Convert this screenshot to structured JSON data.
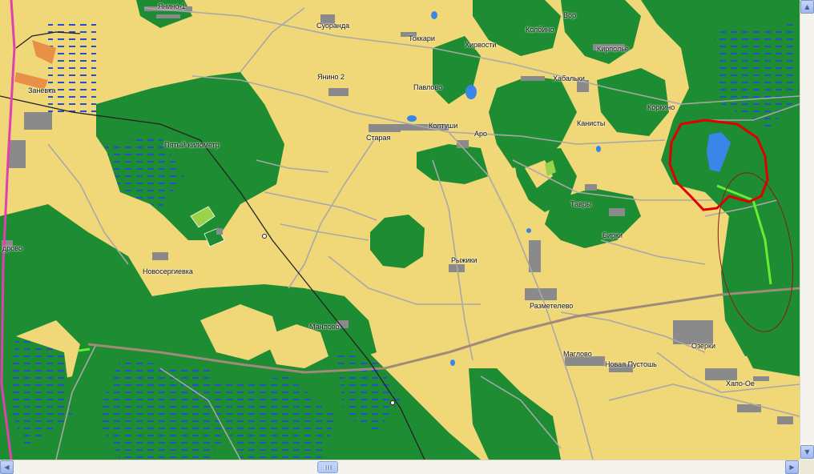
{
  "map": {
    "colors": {
      "field": "#f0d878",
      "forest": "#1e8c32",
      "water": "#3a86e8",
      "building": "#8a8a8a",
      "road": "#a8a8a8",
      "main_road": "#a08a7a",
      "rail": "#222222",
      "annotation_red": "#e00000",
      "track_green": "#66ee33"
    },
    "labels": {
      "yanino1": "Янино-1",
      "suoranda": "Суоранда",
      "tokkari": "Токкари",
      "kolbino": "Колбино",
      "vor": "Вор",
      "khirvosti": "Хирвости",
      "kirpolye": "Кирполье",
      "zanevka": "Заневка",
      "yanino2": "Янино 2",
      "pavlovo": "Павлово",
      "khabalki": "Хабальки",
      "korkino": "Коркино",
      "koltushi": "Колтуши",
      "kanisty": "Канисты",
      "pyatyy_km": "Пятый километр",
      "staraya": "Старая",
      "aro": "Аро",
      "tavry": "Тавры",
      "birki": "Бирки",
      "drovo": "дрово",
      "ryzhiki": "Рыжики",
      "novosergievka": "Новосергиевка",
      "razmetelevo": "Разметелево",
      "manlovo": "Манлово",
      "ozerki": "Озерки",
      "maglovo": "Маглово",
      "novaya_pustosh": "Новая Пустошь",
      "khapo_oe": "Хапо-Ое"
    }
  },
  "scrollbars": {
    "up_icon": "▲",
    "down_icon": "▼",
    "left_icon": "◀",
    "right_icon": "▶"
  }
}
